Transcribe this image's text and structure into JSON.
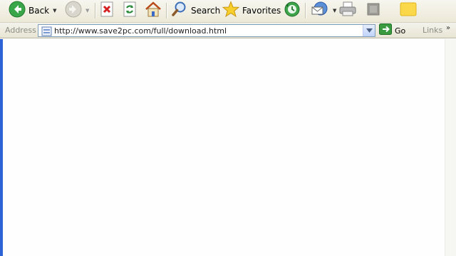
{
  "toolbar": {
    "back_label": "Back",
    "search_label": "Search",
    "favorites_label": "Favorites"
  },
  "address_bar": {
    "label": "Address",
    "url": "http://www.save2pc.com/full/download.html",
    "go_label": "Go",
    "links_label": "Links"
  },
  "icons": [
    "back-icon",
    "forward-icon",
    "stop-icon",
    "refresh-icon",
    "home-icon",
    "search-icon",
    "favorites-star-icon",
    "history-icon",
    "mail-icon",
    "print-icon",
    "edit-icon",
    "messenger-icon",
    "page-icon",
    "go-arrow-icon"
  ],
  "colors": {
    "window_frame": "#2e63d6",
    "toolbar_bg": "#ece9d8",
    "page_bg": "#ffffff"
  }
}
